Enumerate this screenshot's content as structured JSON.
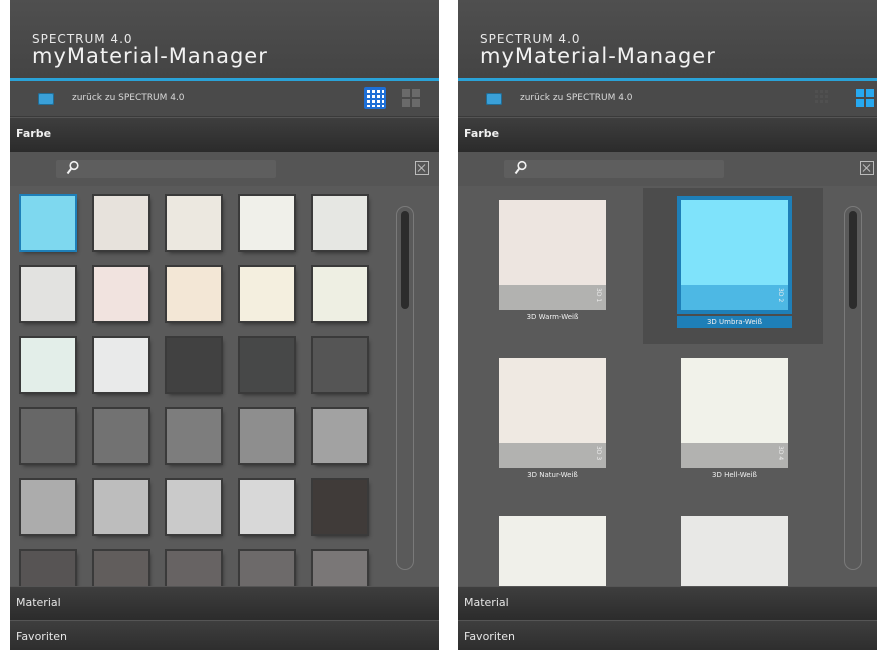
{
  "left_panel": {
    "brand_small": "SPECTRUM 4.0",
    "brand_big": "myMaterial-Manager",
    "back_label": "zurück zu SPECTRUM 4.0",
    "section_color": "Farbe",
    "section_material": "Material",
    "section_favorites": "Favoriten",
    "view_mode": "grid-small",
    "swatches": [
      {
        "color": "#7ed8ef",
        "selected": true
      },
      {
        "color": "#e7e2dc"
      },
      {
        "color": "#ece8e0"
      },
      {
        "color": "#f0f0ea"
      },
      {
        "color": "#e6e7e3"
      },
      {
        "color": "#e2e2e0"
      },
      {
        "color": "#f1e3df"
      },
      {
        "color": "#f3e7d6"
      },
      {
        "color": "#f4efdf"
      },
      {
        "color": "#eeefe3"
      },
      {
        "color": "#e3eee9"
      },
      {
        "color": "#e9eaea"
      },
      {
        "color": "#414141"
      },
      {
        "color": "#474848"
      },
      {
        "color": "#555555"
      },
      {
        "color": "#676767"
      },
      {
        "color": "#727272"
      },
      {
        "color": "#7d7d7d"
      },
      {
        "color": "#8e8e8e"
      },
      {
        "color": "#a2a2a2"
      },
      {
        "color": "#acacac"
      },
      {
        "color": "#bdbdbd"
      },
      {
        "color": "#cacaca"
      },
      {
        "color": "#d8d8d8"
      },
      {
        "color": "#403b39"
      },
      {
        "color": "#575454"
      },
      {
        "color": "#615d5c"
      },
      {
        "color": "#676363"
      },
      {
        "color": "#6d6a6a"
      },
      {
        "color": "#7a7777"
      }
    ]
  },
  "right_panel": {
    "brand_small": "SPECTRUM 4.0",
    "brand_big": "myMaterial-Manager",
    "back_label": "zurück zu SPECTRUM 4.0",
    "section_color": "Farbe",
    "section_material": "Material",
    "section_favorites": "Favoriten",
    "view_mode": "grid-large",
    "tiles": [
      {
        "name": "3D Warm-Weiß",
        "color": "#ede5e0",
        "strip": "#b2b2b0",
        "mark": "3D 1"
      },
      {
        "name": "3D Umbra-Weiß",
        "color": "#7fe3fb",
        "strip": "#4db8e4",
        "mark": "3D 2",
        "selected": true
      },
      {
        "name": "3D Natur-Weiß",
        "color": "#efe9e2",
        "strip": "#b2b2b0",
        "mark": "3D 3"
      },
      {
        "name": "3D Hell-Weiß",
        "color": "#f1f2ea",
        "strip": "#b2b2b0",
        "mark": "3D 4"
      },
      {
        "name": "",
        "color": "#f0f0ea",
        "strip": "#b2b2b0",
        "mark": ""
      },
      {
        "name": "",
        "color": "#e8e8e6",
        "strip": "#b2b2b0",
        "mark": ""
      }
    ]
  },
  "colors": {
    "accent": "#2aa3d8",
    "selection": "#1e7fb8",
    "panel_bg": "#5a5a5a"
  }
}
